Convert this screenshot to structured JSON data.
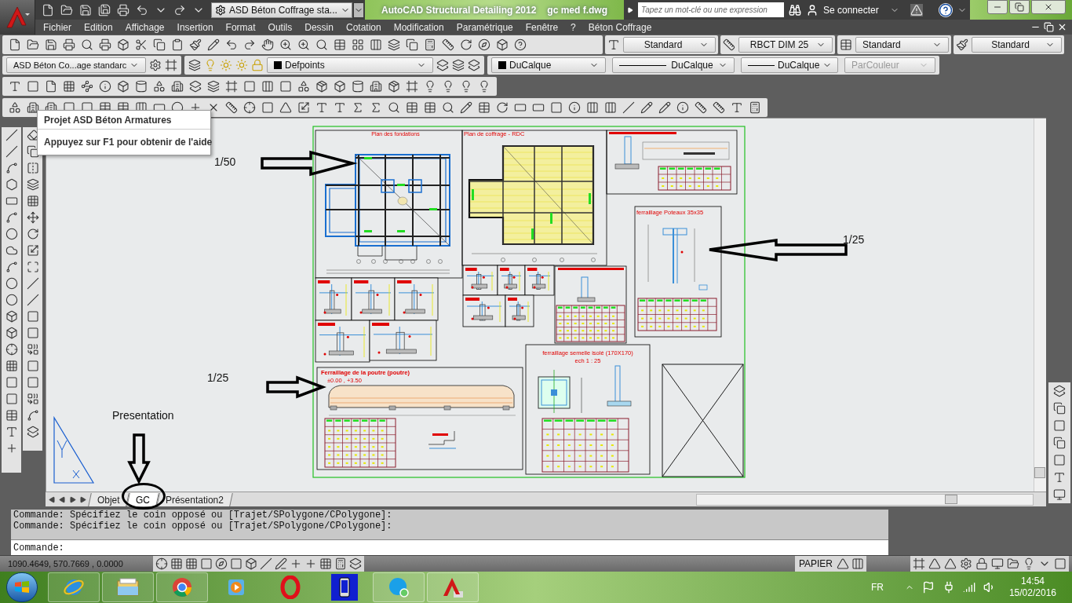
{
  "title_bar": {
    "workspace": "ASD Béton Coffrage sta...",
    "title": "AutoCAD Structural Detailing 2012",
    "file": "gc med f.dwg",
    "search": {
      "placeholder": "Tapez un mot-clé ou une expression"
    },
    "sign_in": "Se connecter"
  },
  "menu": [
    "Fichier",
    "Edition",
    "Affichage",
    "Insertion",
    "Format",
    "Outils",
    "Dessin",
    "Cotation",
    "Modification",
    "Paramétrique",
    "Fenêtre",
    "?",
    "Béton Coffrage"
  ],
  "style_dropdowns": [
    "Standard",
    "RBCT DIM 25",
    "Standard",
    "Standard"
  ],
  "properties_bar": {
    "project_style": "ASD Béton Co...age standarc",
    "layer": "Defpoints",
    "color_control": "DuCalque",
    "linetype": "DuCalque",
    "lineweight": "DuCalque",
    "plot_style": {
      "value": "ParCouleur",
      "disabled": true
    }
  },
  "tooltip": {
    "title": "Projet ASD Béton Armatures",
    "hint": "Appuyez sur F1 pour obtenir de l'aide"
  },
  "drawing": {
    "sheet_titles": [
      "Plan des fondations",
      "Plan de coffrage - RDC",
      "ferraillage Poteaux 35x35",
      "Ferraillage de la poutre (poutre)",
      "±0.00 , +3.50",
      "ferraillage semelle isolé (170X170)",
      "ech 1 : 25"
    ],
    "annotations": [
      "1/50",
      "1/25",
      "1/25",
      "Presentation"
    ]
  },
  "layout_tabs": [
    {
      "label": "Objet",
      "selected": false
    },
    {
      "label": "GC",
      "selected": true
    },
    {
      "label": "Présentation2",
      "selected": false
    }
  ],
  "command_history": [
    "Commande: Spécifiez le coin opposé ou [Trajet/SPolygone/CPolygone]:",
    "Commande: Spécifiez le coin opposé ou [Trajet/SPolygone/CPolygone]:"
  ],
  "command_prompt": "Commande:",
  "status_bar": {
    "coordinates": "1090.4649, 570.7669 , 0.0000",
    "space": "PAPIER"
  },
  "taskbar": {
    "language": "FR",
    "time": "14:54",
    "date": "15/02/2016"
  }
}
